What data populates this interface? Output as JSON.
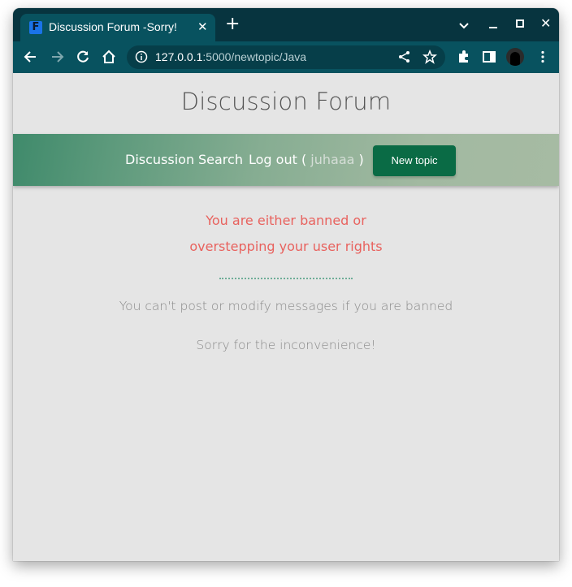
{
  "browser": {
    "tab": {
      "title": "Discussion Forum -Sorry!",
      "favicon_letter": "F"
    },
    "url_host": "127.0.0.1",
    "url_rest": ":5000/newtopic/Java"
  },
  "site": {
    "title": "Discussion Forum",
    "nav": {
      "discussion": "Discussion",
      "search": "Search",
      "logout": "Log out (",
      "user": "juhaaa",
      "logout_close": ")",
      "new_topic": "New topic"
    }
  },
  "error": {
    "line1": "You are either banned or",
    "line2": "overstepping your user rights"
  },
  "messages": {
    "info": "You can't post or modify messages if you are banned",
    "sorry": "Sorry for the inconvenience!"
  },
  "colors": {
    "error": "#e8625e",
    "tab_bar": "#07343f",
    "toolbar": "#08525f",
    "button": "#0a6b45"
  }
}
